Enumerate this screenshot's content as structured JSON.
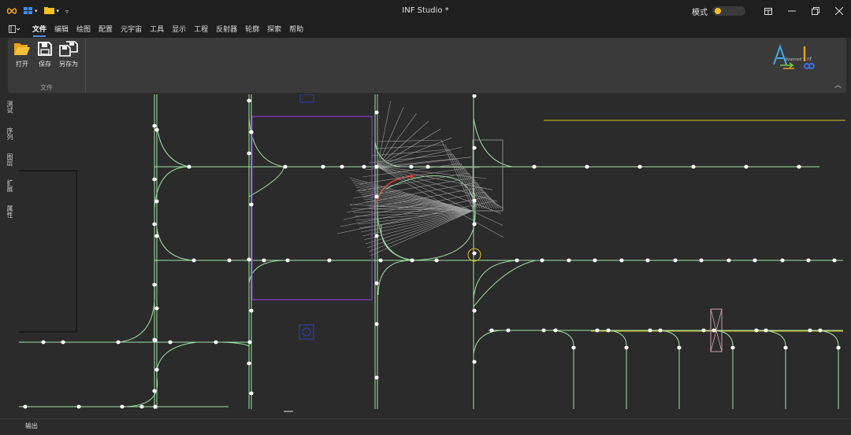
{
  "window": {
    "title": "INF Studio *",
    "mode_label": "模式"
  },
  "titlebar_icons": [
    "infinity-icon",
    "grid-icon",
    "folder-icon",
    "dropdown-icon"
  ],
  "menu": [
    {
      "label": "文件",
      "active": true
    },
    {
      "label": "编辑"
    },
    {
      "label": "绘图"
    },
    {
      "label": "配置"
    },
    {
      "label": "元宇宙"
    },
    {
      "label": "工具"
    },
    {
      "label": "显示"
    },
    {
      "label": "工程"
    },
    {
      "label": "反射器"
    },
    {
      "label": "轮廓"
    },
    {
      "label": "探索"
    },
    {
      "label": "帮助"
    }
  ],
  "ribbon": {
    "buttons": [
      {
        "label": "打开",
        "icon": "folder-open-icon"
      },
      {
        "label": "保存",
        "icon": "save-icon"
      },
      {
        "label": "另存为",
        "icon": "save-as-icon"
      }
    ],
    "group_label": "文件"
  },
  "side_tabs": [
    "测试",
    "序列",
    "图层",
    "扩展",
    "属性"
  ],
  "output": {
    "label": "输出"
  },
  "colors": {
    "track": "#9fe3a3",
    "node": "#ffffff",
    "selection": "#7e3fc4",
    "highlight": "#e0c020",
    "path": "#e03a2a",
    "gray": "#a0a0a0",
    "switch_box": "#d0a0b0",
    "marker": "#2f3fc0"
  }
}
